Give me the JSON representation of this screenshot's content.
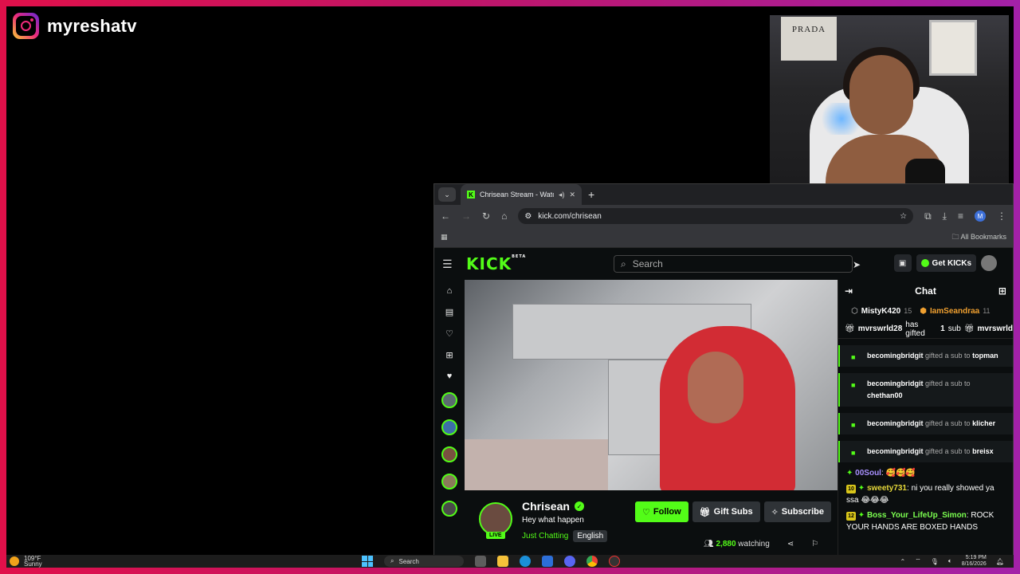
{
  "overlay": {
    "brand_name": "myreshatv",
    "cam_poster_text": "PRADA"
  },
  "browser": {
    "tab_title": "Chrisean Stream - Watch Live",
    "url": "kick.com/chrisean",
    "bookmarks_label": "All Bookmarks",
    "profile_initial": "M"
  },
  "kick": {
    "logo": "KICK",
    "logo_badge": "BETA",
    "search_placeholder": "Search",
    "get_kicks_label": "Get KICKs",
    "channel": {
      "name": "Chrisean",
      "live_label": "LIVE",
      "stream_title": "Hey what happen",
      "category": "Just Chatting",
      "language": "English",
      "follow_label": "Follow",
      "gift_subs_label": "Gift Subs",
      "subscribe_label": "Subscribe",
      "watching_count": "2,880",
      "watching_label": "watching"
    },
    "chat": {
      "title": "Chat",
      "leaderboard": [
        {
          "user": "MistyK420",
          "count": "15"
        },
        {
          "user": "IamSeandraa",
          "count": "11"
        }
      ],
      "pinned_gift": {
        "user": "mvrswrld28",
        "text": "has gifted",
        "count": "1",
        "unit": "sub",
        "user2": "mvrswrld"
      },
      "gifts": [
        {
          "user": "becomingbridgit",
          "text": "gifted a sub to",
          "target": "topman"
        },
        {
          "user": "becomingbridgit",
          "text": "gifted a sub to",
          "target": "chethan00"
        },
        {
          "user": "becomingbridgit",
          "text": "gifted a sub to",
          "target": "klicher"
        },
        {
          "user": "becomingbridgit",
          "text": "gifted a sub to",
          "target": "breisx"
        }
      ],
      "messages": [
        {
          "user": "00Soul",
          "text": "🥰🥰🥰",
          "badge": ""
        },
        {
          "user": "sweety731",
          "text": "ni you really showed ya ssa 😂😂😂",
          "badge": "10"
        },
        {
          "user": "Boss_Your_LifeUp_Simon",
          "text": "ROCK YOUR HANDS ARE BOXED HANDS",
          "badge": "12"
        }
      ]
    }
  },
  "taskbar": {
    "temperature": "109°F",
    "condition": "Sunny",
    "search_label": "Search",
    "time": "5:19 PM",
    "date": "8/16/2026"
  },
  "colors": {
    "kick_green": "#53fc18",
    "frame_start": "#e0104a",
    "frame_end": "#a321a8"
  }
}
